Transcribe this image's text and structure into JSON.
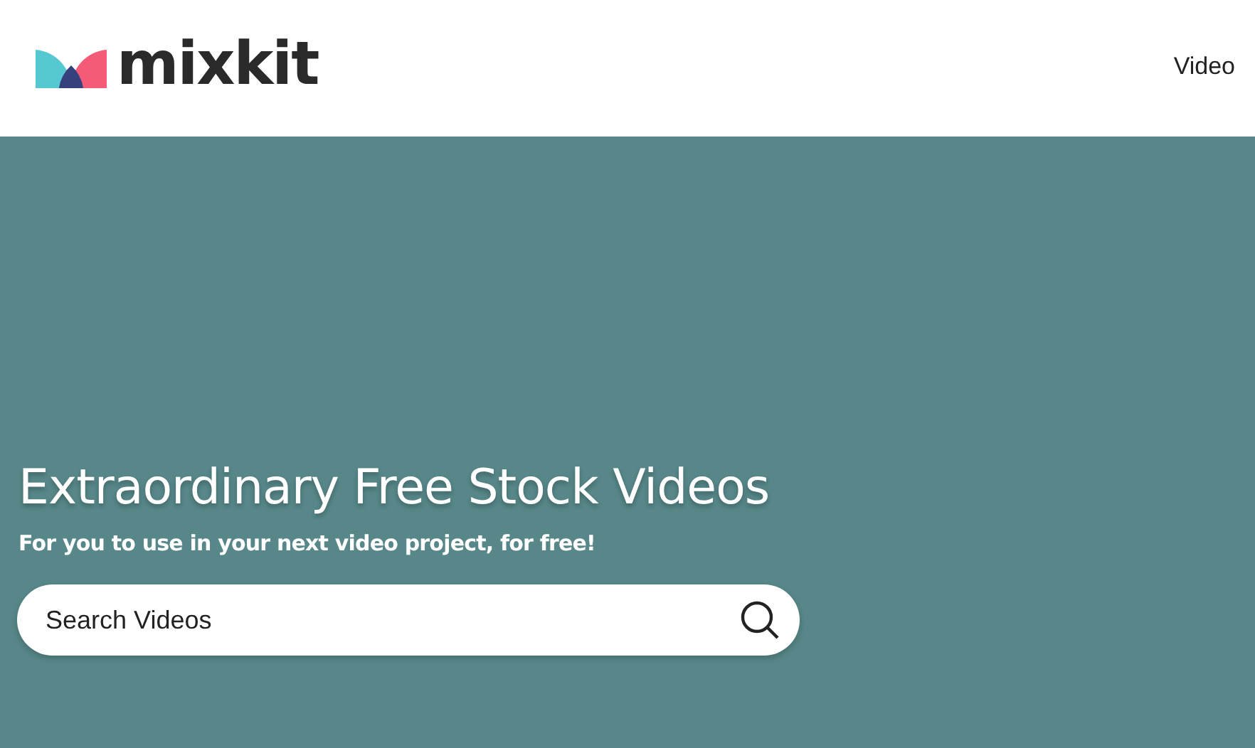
{
  "header": {
    "logo": "mixkit",
    "nav": [
      "Video"
    ]
  },
  "hero": {
    "title": "Extraordinary Free Stock Videos",
    "subtitle": "For you to use in your next video project, for free!",
    "search": {
      "placeholder": "Search Videos"
    }
  }
}
